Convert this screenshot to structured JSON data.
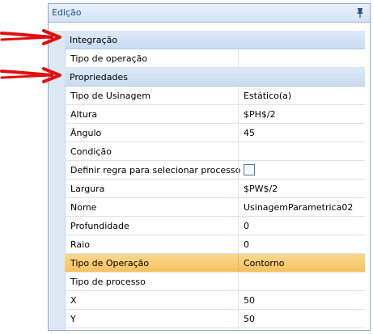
{
  "panel": {
    "title": "Edição",
    "pin_icon": "pin-icon"
  },
  "categories": [
    {
      "label": "Integração"
    },
    {
      "label": "Propriedades"
    }
  ],
  "integration_rows": [
    {
      "name": "Tipo de operação",
      "value": ""
    }
  ],
  "property_rows": [
    {
      "name": "Tipo de Usinagem",
      "value": "Estático(a)"
    },
    {
      "name": "Altura",
      "value": "$PH$/2"
    },
    {
      "name": "Ângulo",
      "value": "45"
    },
    {
      "name": "Condição",
      "value": ""
    },
    {
      "name": "Definir regra para selecionar processo",
      "value": "",
      "type": "checkbox",
      "checked": false
    },
    {
      "name": "Largura",
      "value": "$PW$/2"
    },
    {
      "name": "Nome",
      "value": "UsinagemParametrica02"
    },
    {
      "name": "Profundidade",
      "value": "0"
    },
    {
      "name": "Raio",
      "value": "0"
    },
    {
      "name": "Tipo de Operação",
      "value": "Contorno",
      "selected": true
    },
    {
      "name": "Tipo de processo",
      "value": ""
    },
    {
      "name": "X",
      "value": "50"
    },
    {
      "name": "Y",
      "value": "50"
    }
  ],
  "annotation_arrows": [
    {
      "icon": "red-arrow-icon",
      "color": "#e01010",
      "target": "Integração"
    },
    {
      "icon": "red-arrow-icon",
      "color": "#e01010",
      "target": "Propriedades"
    }
  ],
  "colors": {
    "title_text": "#1f4e8c",
    "category_bg": "#d3e2f4",
    "selected_bg": "#f6c15d",
    "arrow": "#e01010"
  }
}
